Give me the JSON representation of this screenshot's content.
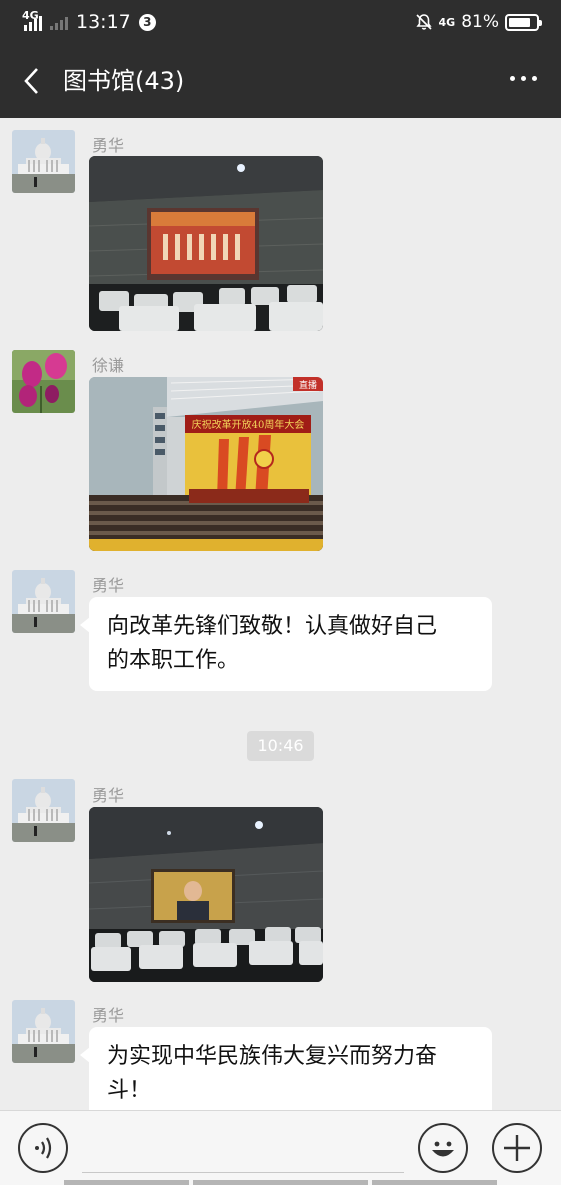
{
  "status_bar": {
    "network_left": "4G",
    "time": "13:17",
    "notification_count": "3",
    "network_right": "4G",
    "battery_percent": "81%",
    "battery_level": 0.81
  },
  "header": {
    "title": "图书馆(43)"
  },
  "messages": [
    {
      "sender": "勇华",
      "type": "image",
      "content": "screening-room-photo"
    },
    {
      "sender": "徐谦",
      "type": "image",
      "content": "anniversary-broadcast-photo",
      "caption_fragment": "庆祝改革开放40周年大会"
    },
    {
      "sender": "勇华",
      "type": "text",
      "lines": [
        "向改革先锋们致敬！认真做好自己",
        "的本职工作。"
      ]
    },
    {
      "type": "timestamp",
      "text": "10:46"
    },
    {
      "sender": "勇华",
      "type": "image",
      "content": "speech-broadcast-photo"
    },
    {
      "sender": "勇华",
      "type": "text",
      "lines": [
        "为实现中华民族伟大复兴而努力奋",
        "斗！"
      ]
    }
  ],
  "poster_text": "庆祝改革开放40周年大会",
  "tv_badge": "直播",
  "icons": {
    "back": "chevron-left-icon",
    "more": "more-dots-icon",
    "voice": "voice-icon",
    "emoji": "emoji-icon",
    "plus": "plus-icon"
  }
}
